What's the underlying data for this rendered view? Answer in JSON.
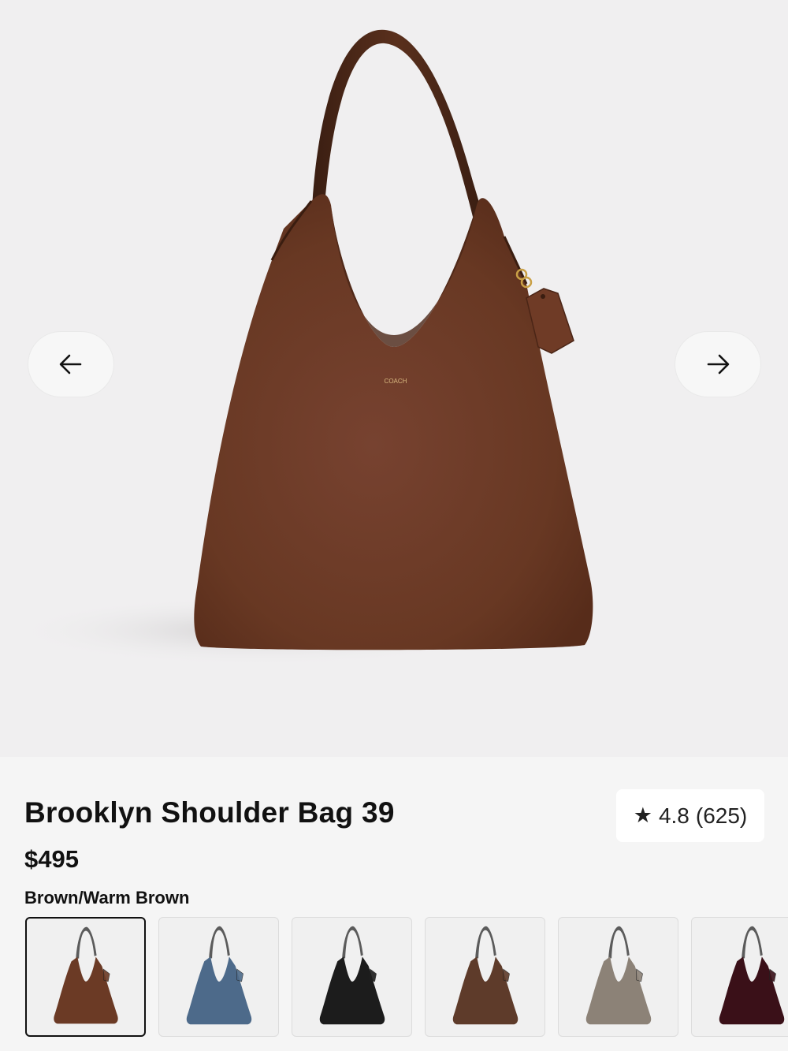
{
  "product": {
    "name": "Brooklyn Shoulder Bag 39",
    "price": "$495",
    "rating": {
      "value": "4.8",
      "count": "(625)",
      "star_icon": "star-icon"
    },
    "hero_colour": "#6a3924",
    "logo_text": "COACH"
  },
  "gallery": {
    "prev_icon": "arrow-left-icon",
    "next_icon": "arrow-right-icon"
  },
  "swatches": [
    {
      "colour": "#6b3a25",
      "selected": true
    },
    {
      "colour": "#4d6a8a",
      "selected": false
    },
    {
      "colour": "#1c1c1c",
      "selected": false
    },
    {
      "colour": "#5e3b2a",
      "selected": false
    },
    {
      "colour": "#8c8277",
      "selected": false
    },
    {
      "colour": "#3a1018",
      "selected": false
    }
  ],
  "selected_colour_label": "Brown/Warm Brown"
}
